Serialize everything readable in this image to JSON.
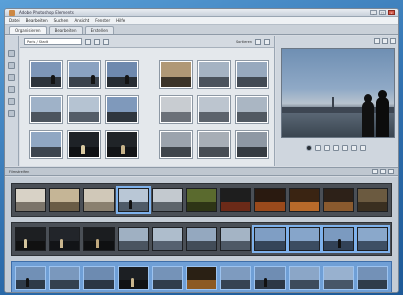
{
  "window": {
    "title": "Adobe Photoshop Elements",
    "buttons": [
      "_",
      "□",
      "×"
    ]
  },
  "menu": {
    "items": [
      "Datei",
      "Bearbeiten",
      "Suchen",
      "Ansicht",
      "Fenster",
      "Hilfe"
    ]
  },
  "tabs": [
    {
      "label": "Organisieren",
      "active": true
    },
    {
      "label": "Bearbeiten",
      "active": false
    },
    {
      "label": "Erstellen",
      "active": false
    }
  ],
  "browser": {
    "path": "Paris / Stadt",
    "sort_label": "Sortieren"
  },
  "filmstrip": {
    "label": "Filmstreifen"
  },
  "colors": {
    "accent": "#7fb2ec",
    "window_bg": "#d6dbe2",
    "strip_bg": "#4a4f56"
  }
}
